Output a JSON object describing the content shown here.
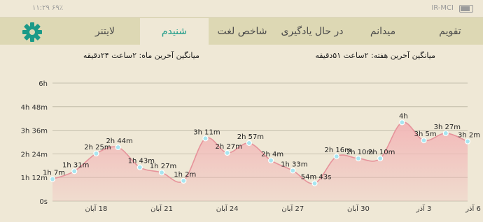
{
  "status_bar": {
    "left_text": "۱۱:۲۹ ۶۹٪",
    "right_text": "IR-MCI"
  },
  "tabs": [
    {
      "label": "تقویم",
      "active": false
    },
    {
      "label": "میدانم",
      "active": false
    },
    {
      "label": "در حال یادگیری",
      "active": false
    },
    {
      "label": "شاخص لغت",
      "active": false
    },
    {
      "label": "شنیدم",
      "active": true
    },
    {
      "label": "لایتنر",
      "active": false
    }
  ],
  "colors": {
    "accent": "#1b9a88",
    "area_fill": "#f2b8b8",
    "line": "#e6939b",
    "marker": "#a8e6f0"
  },
  "averages": {
    "week": "میانگین آخرین هفته: ۲ساعت ۵۱دقیقه",
    "month": "میانگین آخرین ماه: ۲ساعت ۲۴دقیقه"
  },
  "chart_data": {
    "type": "area",
    "y_ticks": [
      "0s",
      "1h 12m",
      "2h 24m",
      "3h 36m",
      "4h 48m",
      "6h"
    ],
    "ylim": [
      0,
      360
    ],
    "x_tick_labels": [
      "18 آبان",
      "21 آبان",
      "24 آبان",
      "27 آبان",
      "30 آبان",
      "3 آذر",
      "6 آذر"
    ],
    "points": [
      {
        "day": "16 آبان",
        "minutes": 67,
        "label": "1h 7m"
      },
      {
        "day": "17 آبان",
        "minutes": 91,
        "label": "1h 31m"
      },
      {
        "day": "18 آبان",
        "minutes": 145,
        "label": "2h 25m"
      },
      {
        "day": "19 آبان",
        "minutes": 164,
        "label": "2h 44m"
      },
      {
        "day": "20 آبان",
        "minutes": 103,
        "label": "1h 43m"
      },
      {
        "day": "21 آبان",
        "minutes": 87,
        "label": "1h 27m"
      },
      {
        "day": "22 آبان",
        "minutes": 62,
        "label": "1h 2m"
      },
      {
        "day": "23 آبان",
        "minutes": 191,
        "label": "3h 11m"
      },
      {
        "day": "24 آبان",
        "minutes": 147,
        "label": "2h 27m"
      },
      {
        "day": "25 آبان",
        "minutes": 177,
        "label": "2h 57m"
      },
      {
        "day": "26 آبان",
        "minutes": 124,
        "label": "2h 4m"
      },
      {
        "day": "27 آبان",
        "minutes": 93,
        "label": "1h 33m"
      },
      {
        "day": "28 آبان",
        "minutes": 54,
        "label": "54m 43s"
      },
      {
        "day": "29 آبان",
        "minutes": 136,
        "label": "2h 16m"
      },
      {
        "day": "30 آبان",
        "minutes": 130,
        "label": "2h 10m"
      },
      {
        "day": "1 آذر",
        "minutes": 130,
        "label": "2h 10m"
      },
      {
        "day": "2 آذر",
        "minutes": 240,
        "label": "4h"
      },
      {
        "day": "3 آذر",
        "minutes": 185,
        "label": "3h 5m"
      },
      {
        "day": "4 آذر",
        "minutes": 207,
        "label": "3h 27m"
      },
      {
        "day": "5 آذر",
        "minutes": 182,
        "label": "3h 2m"
      }
    ]
  }
}
